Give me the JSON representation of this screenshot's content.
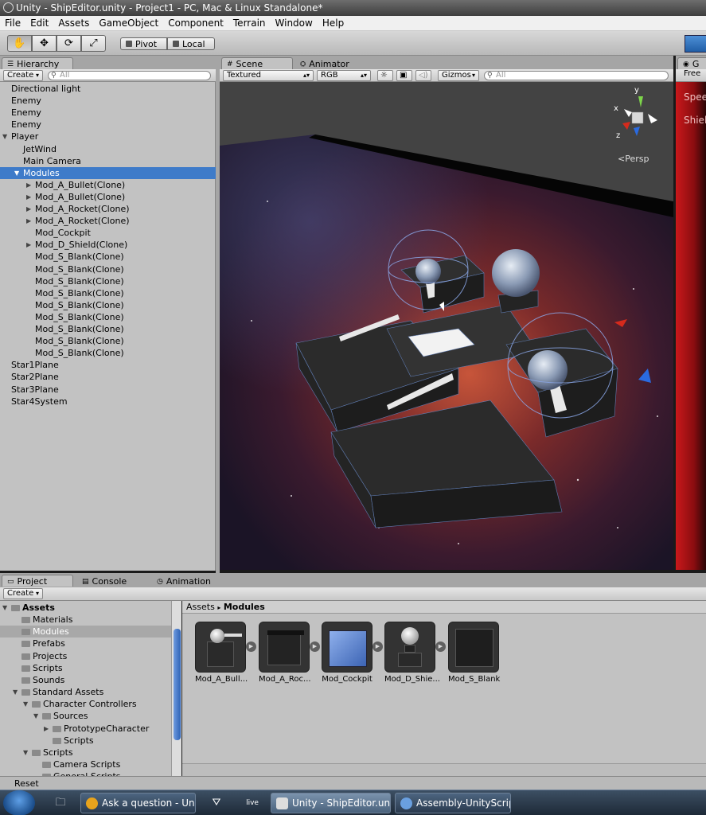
{
  "window": {
    "title": "Unity - ShipEditor.unity - Project1 - PC, Mac & Linux Standalone*"
  },
  "menu": [
    "File",
    "Edit",
    "Assets",
    "GameObject",
    "Component",
    "Terrain",
    "Window",
    "Help"
  ],
  "toolbar": {
    "pivot_label": "Pivot",
    "local_label": "Local"
  },
  "hierarchy": {
    "tab_label": "Hierarchy",
    "create_label": "Create",
    "search_placeholder": "All",
    "items": [
      {
        "label": "Directional light",
        "indent": 0
      },
      {
        "label": "Enemy",
        "indent": 0
      },
      {
        "label": "Enemy",
        "indent": 0
      },
      {
        "label": "Enemy",
        "indent": 0
      },
      {
        "label": "Player",
        "indent": 0,
        "expand": "open"
      },
      {
        "label": "JetWind",
        "indent": 1
      },
      {
        "label": "Main Camera",
        "indent": 1
      },
      {
        "label": "Modules",
        "indent": 1,
        "expand": "open",
        "selected": true
      },
      {
        "label": "Mod_A_Bullet(Clone)",
        "indent": 2,
        "expand": "closed"
      },
      {
        "label": "Mod_A_Bullet(Clone)",
        "indent": 2,
        "expand": "closed"
      },
      {
        "label": "Mod_A_Rocket(Clone)",
        "indent": 2,
        "expand": "closed"
      },
      {
        "label": "Mod_A_Rocket(Clone)",
        "indent": 2,
        "expand": "closed"
      },
      {
        "label": "Mod_Cockpit",
        "indent": 2
      },
      {
        "label": "Mod_D_Shield(Clone)",
        "indent": 2,
        "expand": "closed"
      },
      {
        "label": "Mod_S_Blank(Clone)",
        "indent": 2
      },
      {
        "label": "Mod_S_Blank(Clone)",
        "indent": 2
      },
      {
        "label": "Mod_S_Blank(Clone)",
        "indent": 2
      },
      {
        "label": "Mod_S_Blank(Clone)",
        "indent": 2
      },
      {
        "label": "Mod_S_Blank(Clone)",
        "indent": 2
      },
      {
        "label": "Mod_S_Blank(Clone)",
        "indent": 2
      },
      {
        "label": "Mod_S_Blank(Clone)",
        "indent": 2
      },
      {
        "label": "Mod_S_Blank(Clone)",
        "indent": 2
      },
      {
        "label": "Mod_S_Blank(Clone)",
        "indent": 2
      },
      {
        "label": "Star1Plane",
        "indent": 0
      },
      {
        "label": "Star2Plane",
        "indent": 0
      },
      {
        "label": "Star3Plane",
        "indent": 0
      },
      {
        "label": "Star4System",
        "indent": 0
      }
    ]
  },
  "scene": {
    "tab_scene": "Scene",
    "tab_animator": "Animator",
    "render_mode": "Textured",
    "color_mode": "RGB",
    "gizmos_label": "Gizmos",
    "search_placeholder": "All",
    "persp_label": "Persp",
    "axis_x": "x",
    "axis_y": "y",
    "axis_z": "z"
  },
  "game": {
    "tab_label": "G",
    "sub_label": "Free",
    "speed_label": "Spee",
    "shield_label": "Shiel"
  },
  "project": {
    "tab_project": "Project",
    "tab_console": "Console",
    "tab_animation": "Animation",
    "create_label": "Create",
    "tree": [
      {
        "label": "Assets",
        "indent": 0,
        "expand": "open",
        "bold": true
      },
      {
        "label": "Materials",
        "indent": 1
      },
      {
        "label": "Modules",
        "indent": 1,
        "selected": true
      },
      {
        "label": "Prefabs",
        "indent": 1
      },
      {
        "label": "Projects",
        "indent": 1
      },
      {
        "label": "Scripts",
        "indent": 1
      },
      {
        "label": "Sounds",
        "indent": 1
      },
      {
        "label": "Standard Assets",
        "indent": 1,
        "expand": "open"
      },
      {
        "label": "Character Controllers",
        "indent": 2,
        "expand": "open"
      },
      {
        "label": "Sources",
        "indent": 3,
        "expand": "open"
      },
      {
        "label": "PrototypeCharacter",
        "indent": 4,
        "expand": "closed"
      },
      {
        "label": "Scripts",
        "indent": 4
      },
      {
        "label": "Scripts",
        "indent": 2,
        "expand": "open"
      },
      {
        "label": "Camera Scripts",
        "indent": 3
      },
      {
        "label": "General Scripts",
        "indent": 3
      }
    ],
    "breadcrumb_root": "Assets",
    "breadcrumb_sep": "▸",
    "breadcrumb_current": "Modules",
    "assets": [
      {
        "name": "Mod_A_Bull...",
        "kind": "bullet"
      },
      {
        "name": "Mod_A_Roc...",
        "kind": "rocket"
      },
      {
        "name": "Mod_Cockpit",
        "kind": "cockpit"
      },
      {
        "name": "Mod_D_Shie...",
        "kind": "shield"
      },
      {
        "name": "Mod_S_Blank",
        "kind": "blank"
      }
    ]
  },
  "status": {
    "text": "Reset"
  },
  "taskbar": {
    "items": [
      {
        "label": "Ask a question - Unit...",
        "icon_color": "#e8a31c"
      },
      {
        "label": "Unity - ShipEditor.un...",
        "icon_color": "#dddddd",
        "active": true
      },
      {
        "label": "Assembly-UnityScrip...",
        "icon_color": "#6aa0e0"
      }
    ],
    "live_label": "live"
  }
}
